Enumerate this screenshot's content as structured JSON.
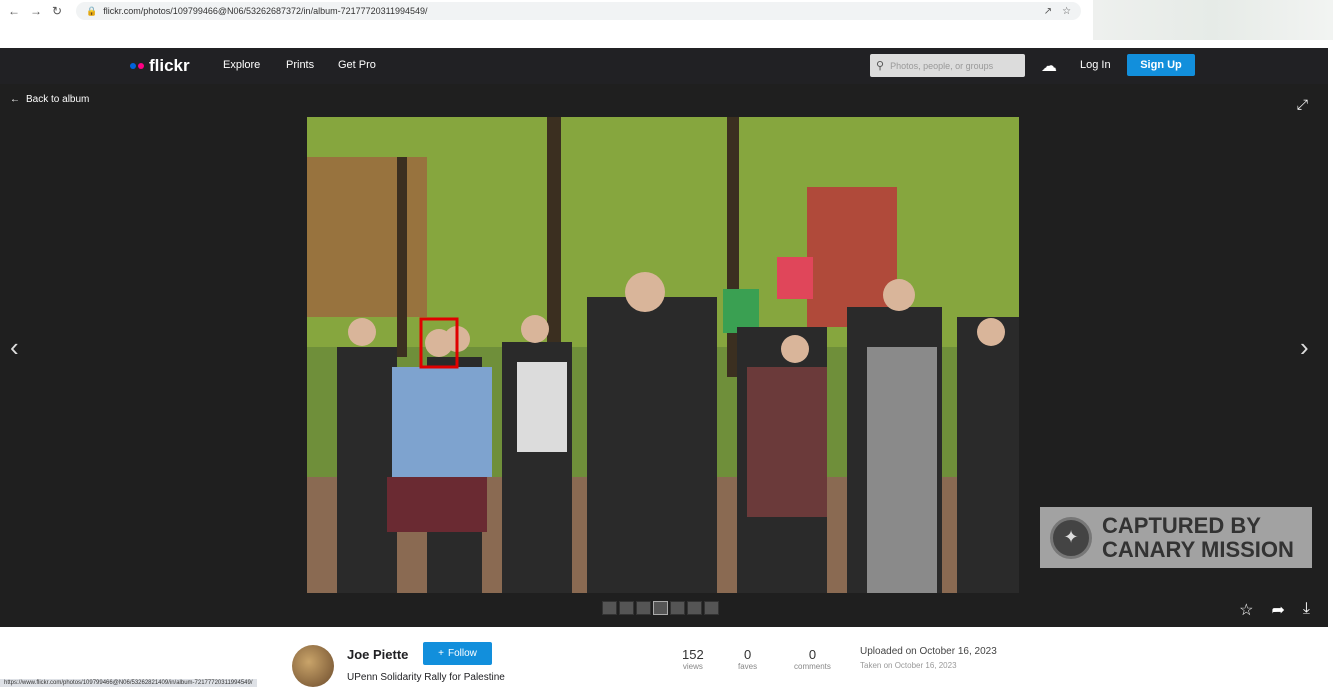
{
  "browser": {
    "url": "flickr.com/photos/109799466@N06/53262687372/in/album-72177720311994549/",
    "status_url": "https://www.flickr.com/photos/109799466@N06/53262821409/in/album-72177720311994549/"
  },
  "header": {
    "logo_text": "flickr",
    "nav": [
      "Explore",
      "Prints",
      "Get Pro"
    ],
    "search_placeholder": "Photos, people, or groups",
    "login_label": "Log In",
    "signup_label": "Sign Up"
  },
  "viewer": {
    "back_label": "Back to album",
    "watermark_line1": "CAPTURED BY",
    "watermark_line2": "CANARY MISSION"
  },
  "info": {
    "author": "Joe Piette",
    "follow_label": "Follow",
    "photo_title": "UPenn Solidarity Rally for Palestine",
    "stats": [
      {
        "value": "152",
        "label": "views"
      },
      {
        "value": "0",
        "label": "faves"
      },
      {
        "value": "0",
        "label": "comments"
      }
    ],
    "uploaded": "Uploaded on October 16, 2023",
    "taken": "Taken on October 16, 2023"
  },
  "colors": {
    "flickr_blue": "#0063dc",
    "flickr_pink": "#ff0084",
    "signup_blue": "#128fdc",
    "highlight_red": "#e00000"
  }
}
